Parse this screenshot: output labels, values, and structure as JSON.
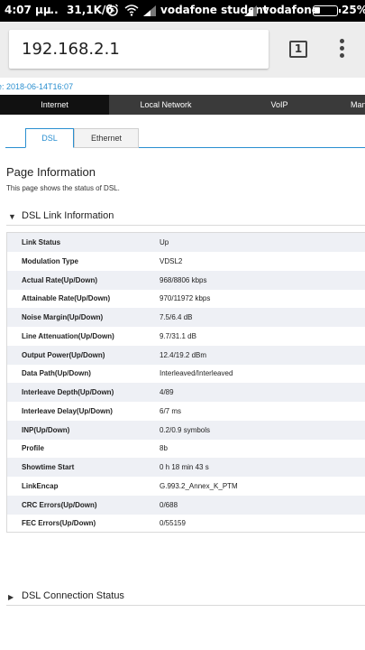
{
  "status_bar": {
    "time": "4:07 μμ",
    "dots": "...",
    "speed": "31,1K/б",
    "carrier1": "vodafone student",
    "carrier2": "vodafone",
    "battery": "25%",
    "battery_level": 0.25
  },
  "browser": {
    "url": "192.168.2.1",
    "tab_count": "1"
  },
  "page": {
    "timeline_prefix": "e: ",
    "timeline_value": "2018-06-14T16:07",
    "nav_tabs": [
      {
        "label": "Internet",
        "active": true
      },
      {
        "label": "Local Network",
        "active": false
      },
      {
        "label": "VoIP",
        "active": false
      },
      {
        "label": "Mana",
        "active": false
      }
    ],
    "sub_tabs": [
      {
        "label": "DSL",
        "active": true
      },
      {
        "label": "Ethernet",
        "active": false
      }
    ],
    "title": "Page Information",
    "description": "This page shows the status of DSL.",
    "section_link": {
      "arrow": "▼",
      "title": "DSL Link Information"
    },
    "link_info": [
      {
        "key": "Link Status",
        "value": "Up"
      },
      {
        "key": "Modulation Type",
        "value": "VDSL2"
      },
      {
        "key": "Actual Rate(Up/Down)",
        "value": "968/8806 kbps"
      },
      {
        "key": "Attainable Rate(Up/Down)",
        "value": "970/11972 kbps"
      },
      {
        "key": "Noise Margin(Up/Down)",
        "value": "7.5/6.4 dB"
      },
      {
        "key": "Line Attenuation(Up/Down)",
        "value": "9.7/31.1 dB"
      },
      {
        "key": "Output Power(Up/Down)",
        "value": "12.4/19.2 dBm"
      },
      {
        "key": "Data Path(Up/Down)",
        "value": "Interleaved/Interleaved"
      },
      {
        "key": "Interleave Depth(Up/Down)",
        "value": "4/89"
      },
      {
        "key": "Interleave Delay(Up/Down)",
        "value": "6/7 ms"
      },
      {
        "key": "INP(Up/Down)",
        "value": "0.2/0.9 symbols"
      },
      {
        "key": "Profile",
        "value": "8b"
      },
      {
        "key": "Showtime Start",
        "value": "0 h 18 min 43 s"
      },
      {
        "key": "LinkEncap",
        "value": "G.993.2_Annex_K_PTM"
      },
      {
        "key": "CRC Errors(Up/Down)",
        "value": "0/688"
      },
      {
        "key": "FEC Errors(Up/Down)",
        "value": "0/55159"
      }
    ],
    "section_conn": {
      "arrow": "▶",
      "title": "DSL Connection Status"
    }
  },
  "colors": {
    "accent": "#2a8fd0",
    "nav_bg": "#3a3a3a",
    "nav_active": "#111111",
    "row_shade": "#eef0f5"
  }
}
